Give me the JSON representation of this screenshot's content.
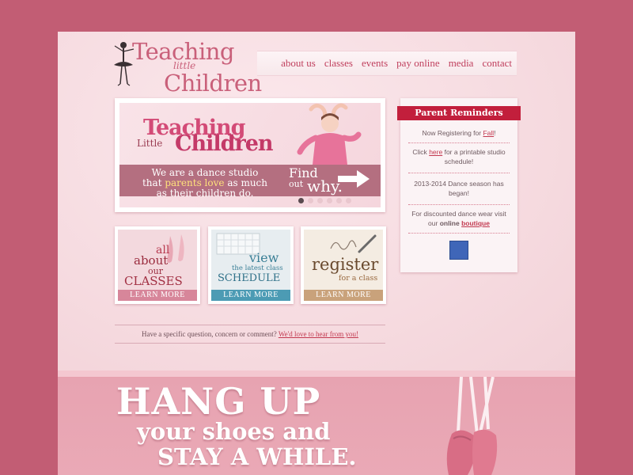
{
  "colors": {
    "background": "#c25d74",
    "accent": "#c0405e",
    "reminder_header": "#c21f3c"
  },
  "logo": {
    "line1": "Teaching",
    "line2": "little",
    "line3": "Children"
  },
  "nav": {
    "items": [
      "about us",
      "classes",
      "events",
      "pay online",
      "media",
      "contact"
    ]
  },
  "hero": {
    "title_line1": "Teaching",
    "title_line2": "Little",
    "title_line3": "Children",
    "text_before": "We are a dance studio",
    "text_that": "that",
    "text_highlight": "parents love",
    "text_after": "as much",
    "text_end": "as their children do.",
    "find": "Find",
    "out": "out",
    "why": "why.",
    "slide_count": 6,
    "active_slide": 1
  },
  "reminders": {
    "title": "Parent Reminders",
    "item1_before": "Now Registering for",
    "item1_link": "Fall",
    "item1_after": "!",
    "item2_before": "Click",
    "item2_link": "here",
    "item2_after": "for a printable studio schedule!",
    "item3": "2013-2014 Dance season has began!",
    "item4_before": "For discounted dance wear visit our",
    "item4_bold": "online",
    "item4_link": "boutique"
  },
  "cards": {
    "classes": {
      "l1": "all",
      "l2": "about",
      "l3": "our",
      "l4": "CLASSES",
      "button": "LEARN MORE"
    },
    "schedule": {
      "l1": "view",
      "l2": "the latest class",
      "l3": "SCHEDULE",
      "button": "LEARN MORE"
    },
    "register": {
      "l1": "register",
      "l2": "for a class",
      "button": "LEARN MORE"
    }
  },
  "contact": {
    "text": "Have a specific question, concern or comment?",
    "link": "We'd love to hear from you!"
  },
  "lower": {
    "line1": "HANG UP",
    "line2": "your shoes and",
    "line3": "STAY A WHILE."
  }
}
